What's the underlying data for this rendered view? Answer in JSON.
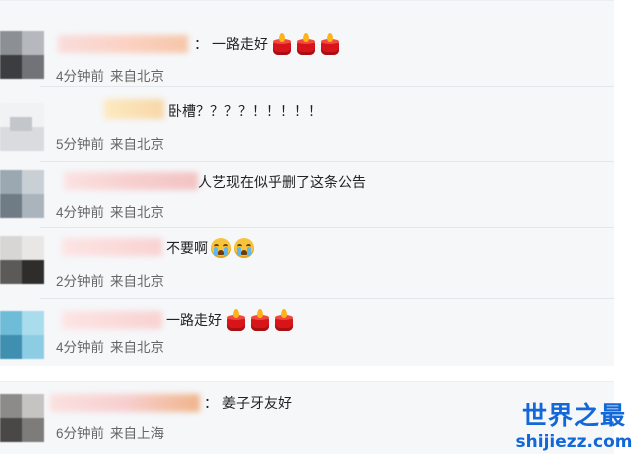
{
  "comments": [
    {
      "text": "一路走好",
      "colon": "：",
      "emoji": [
        "candle",
        "candle",
        "candle"
      ],
      "time": "4分钟前",
      "location": "来自北京"
    },
    {
      "text": "卧槽？？？？！！！！！",
      "colon": "",
      "emoji": [],
      "time": "5分钟前",
      "location": "来自北京"
    },
    {
      "text": "人艺现在似乎删了这条公告",
      "colon": "",
      "emoji": [],
      "time": "4分钟前",
      "location": "来自北京"
    },
    {
      "text": "不要啊",
      "colon": "",
      "emoji": [
        "crying-face",
        "crying-face"
      ],
      "time": "2分钟前",
      "location": "来自北京"
    },
    {
      "text": "一路走好",
      "colon": "",
      "emoji": [
        "candle",
        "candle",
        "candle"
      ],
      "time": "4分钟前",
      "location": "来自北京"
    },
    {
      "text": "姜子牙友好",
      "colon": "：",
      "emoji": [],
      "time": "6分钟前",
      "location": "来自上海"
    }
  ],
  "watermark": {
    "title": "世界之最",
    "url": "shijiezz.com"
  },
  "colors": {
    "panel": "#f6f7f9",
    "meta_text": "#666666",
    "watermark": "#1267d9",
    "candle": "#d7141a"
  }
}
